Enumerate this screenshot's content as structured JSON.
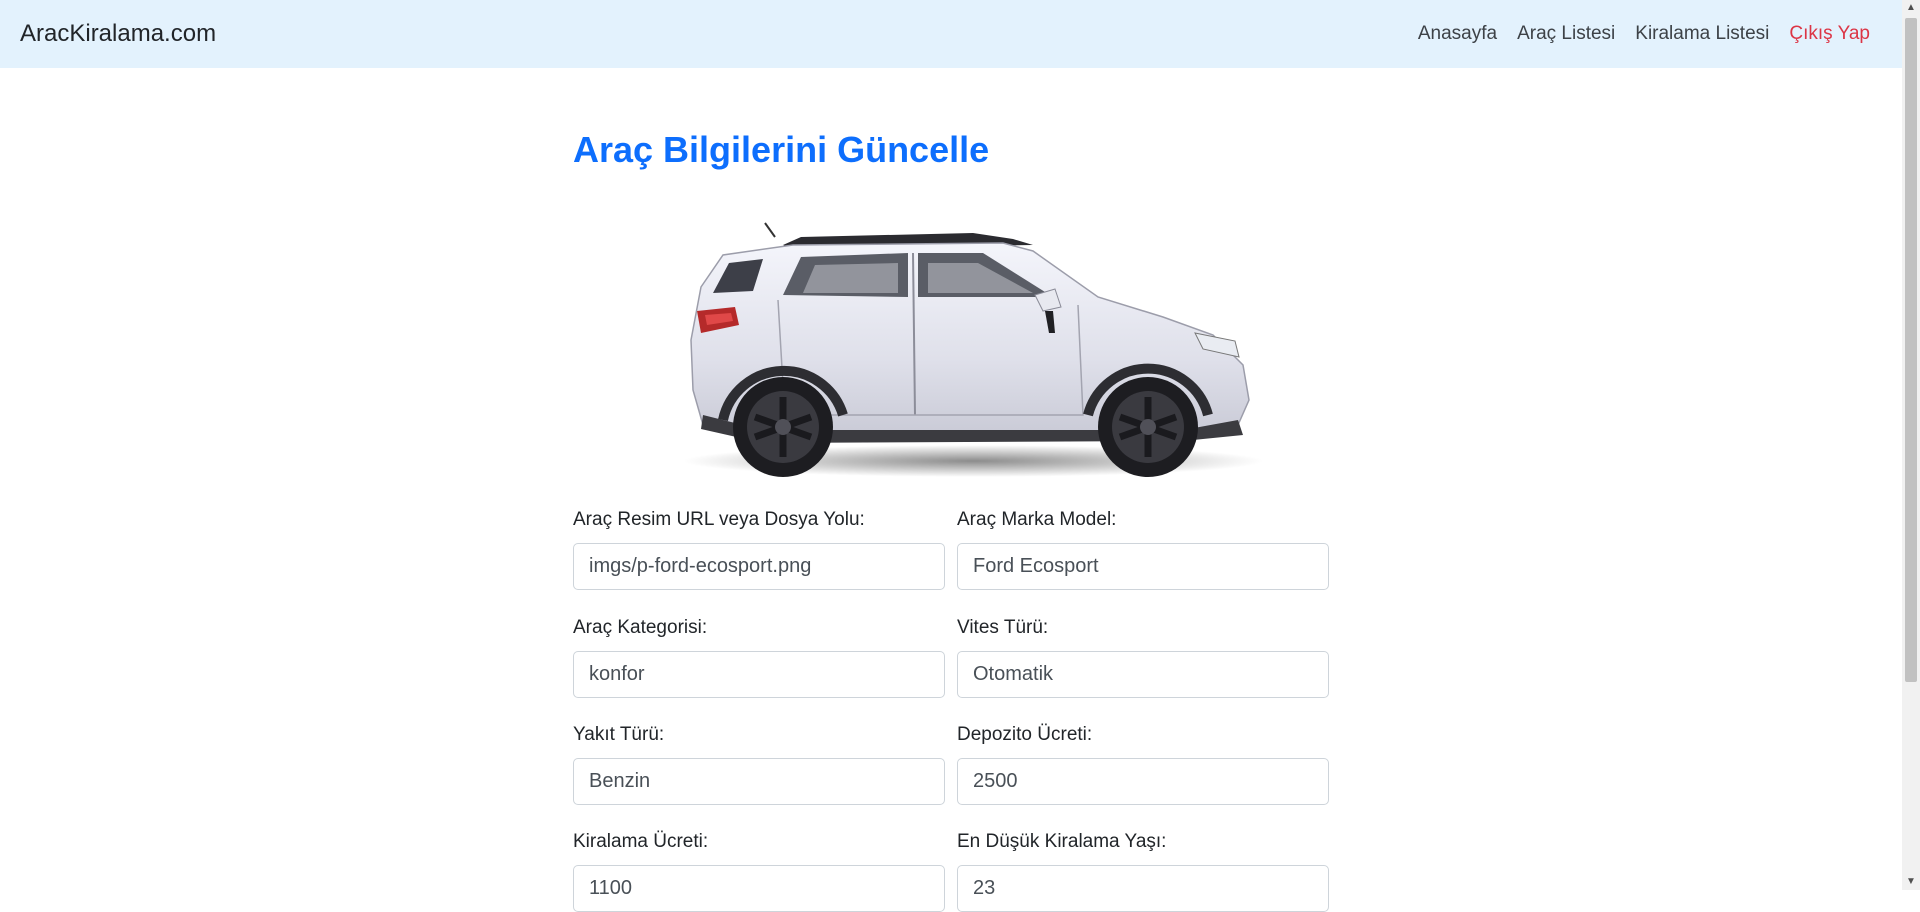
{
  "navbar": {
    "brand": "AracKiralama.com",
    "links": [
      {
        "label": "Anasayfa"
      },
      {
        "label": "Araç Listesi"
      },
      {
        "label": "Kiralama Listesi"
      },
      {
        "label": "Çıkış Yap"
      }
    ]
  },
  "page": {
    "title": "Araç Bilgilerini Güncelle",
    "image_icon": "car-image"
  },
  "form": {
    "fields": [
      {
        "label": "Araç Resim URL veya Dosya Yolu:",
        "value": "imgs/p-ford-ecosport.png"
      },
      {
        "label": "Araç Marka Model:",
        "value": "Ford Ecosport"
      },
      {
        "label": "Araç Kategorisi:",
        "value": "konfor"
      },
      {
        "label": "Vites Türü:",
        "value": "Otomatik"
      },
      {
        "label": "Yakıt Türü:",
        "value": "Benzin"
      },
      {
        "label": "Depozito Ücreti:",
        "value": "2500"
      },
      {
        "label": "Kiralama Ücreti:",
        "value": "1100"
      },
      {
        "label": "En Düşük Kiralama Yaşı:",
        "value": "23"
      }
    ]
  },
  "colors": {
    "navbar_bg": "#e3f2fd",
    "title": "#0d6efd",
    "logout": "#dc3545"
  }
}
